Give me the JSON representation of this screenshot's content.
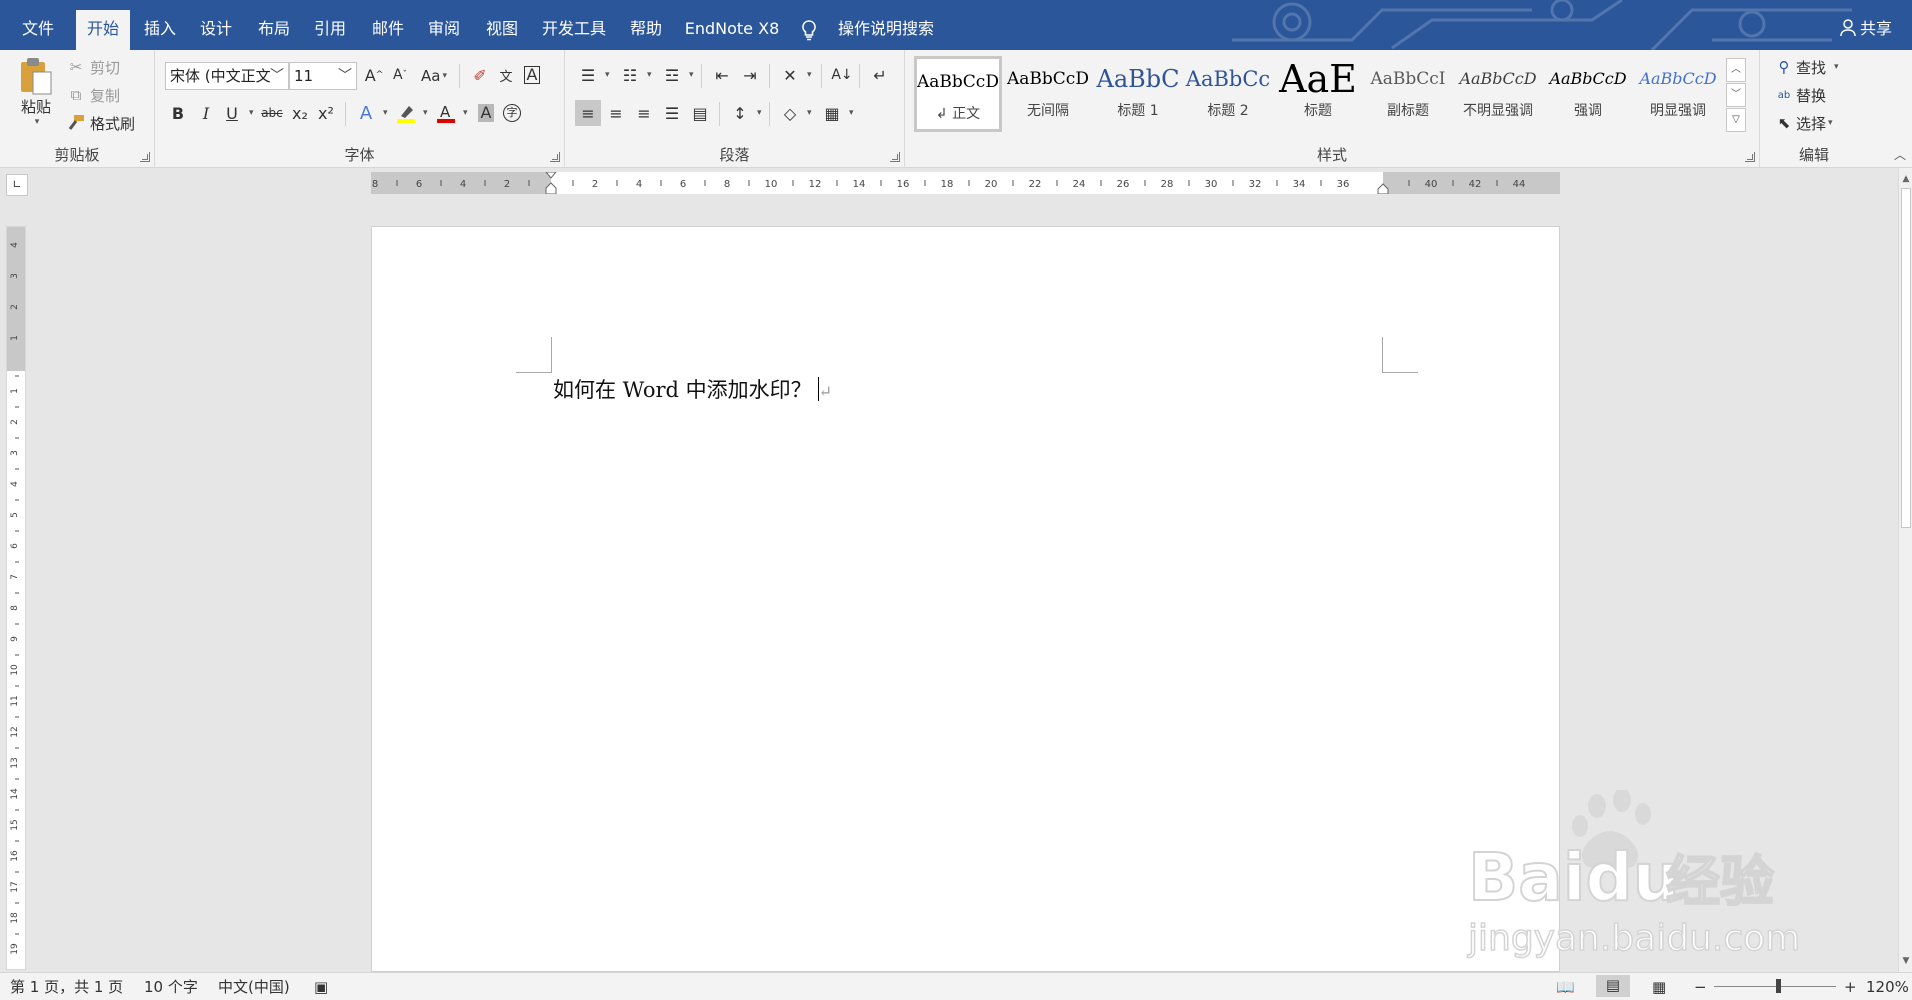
{
  "tabs": [
    "文件",
    "开始",
    "插入",
    "设计",
    "布局",
    "引用",
    "邮件",
    "审阅",
    "视图",
    "开发工具",
    "帮助",
    "EndNote X8"
  ],
  "active_tab": "开始",
  "tell_me": "操作说明搜索",
  "share": "共享",
  "clipboard": {
    "paste": "粘贴",
    "cut": "剪切",
    "copy": "复制",
    "format_painter": "格式刷",
    "label": "剪贴板"
  },
  "font": {
    "name": "宋体 (中文正文",
    "size": "11",
    "change_case": "Aa",
    "bold": "B",
    "italic": "I",
    "underline": "U",
    "strike": "abc",
    "subscript": "x₂",
    "superscript": "x²",
    "label": "字体"
  },
  "paragraph": {
    "label": "段落"
  },
  "styles": {
    "label": "样式",
    "items": [
      {
        "preview": "AaBbCcD",
        "name": "正文",
        "color": "#000000"
      },
      {
        "preview": "AaBbCcD",
        "name": "无间隔",
        "color": "#000000"
      },
      {
        "preview": "AaBbC",
        "name": "标题 1",
        "color": "#2f5496"
      },
      {
        "preview": "AaBbCc",
        "name": "标题 2",
        "color": "#2f5496"
      },
      {
        "preview": "AaE",
        "name": "标题",
        "color": "#000000"
      },
      {
        "preview": "AaBbCcI",
        "name": "副标题",
        "color": "#595959"
      },
      {
        "preview": "AaBbCcD",
        "name": "不明显强调",
        "color": "#404040"
      },
      {
        "preview": "AaBbCcD",
        "name": "强调",
        "color": "#000000"
      },
      {
        "preview": "AaBbCcD",
        "name": "明显强调",
        "color": "#4472c4"
      }
    ]
  },
  "editing": {
    "find": "查找",
    "replace": "替换",
    "select": "选择",
    "label": "编辑"
  },
  "ruler": {
    "h_left_labels": [
      "8",
      "6",
      "4",
      "2"
    ],
    "h_right_labels": [
      "2",
      "4",
      "6",
      "8",
      "10",
      "12",
      "14",
      "16",
      "18",
      "20",
      "22",
      "24",
      "26",
      "28",
      "30",
      "32",
      "34",
      "36",
      "40",
      "42",
      "44"
    ],
    "v_top_labels": [
      "4",
      "3",
      "2",
      "1"
    ],
    "v_labels": [
      "1",
      "2",
      "3",
      "4",
      "5",
      "6",
      "7",
      "8",
      "9",
      "10",
      "11",
      "12",
      "13",
      "14",
      "15",
      "16",
      "17",
      "18",
      "19"
    ]
  },
  "document": {
    "text": "如何在 Word 中添加水印？",
    "para_mark": "↵"
  },
  "status": {
    "page": "第 1 页，共 1 页",
    "words": "10 个字",
    "language": "中文(中国)",
    "zoom": "120%"
  },
  "watermark": {
    "brand": "Baidu",
    "cn": "经验",
    "url": "jingyan.baidu.com"
  },
  "colors": {
    "accent": "#2b579a",
    "ribbon_bg": "#f3f3f3",
    "canvas_bg": "#e6e6e6",
    "font_color_bar": "#e00000",
    "highlight_bar": "#ffff00"
  }
}
